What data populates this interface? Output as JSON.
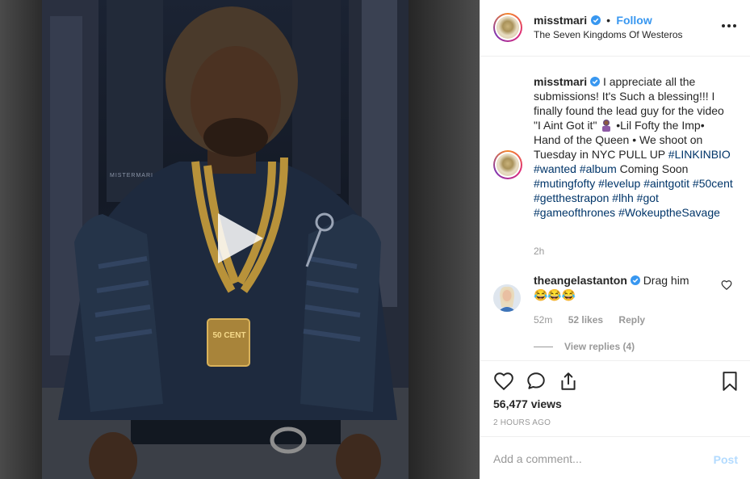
{
  "post": {
    "username": "misstmari",
    "follow_label": "Follow",
    "separator": "•",
    "location": "The Seven Kingdoms Of Westeros",
    "caption": {
      "text_1": "I appreciate all the submissions! It's Such a blessing!!! I finally found the lead guy for the video \"I Aint Got it\"",
      "text_2": "•Lil Fofty the Imp• Hand of the Queen • We shoot on Tuesday in NYC PULL UP",
      "hashtags_1": [
        "#LINKINBIO",
        "#wanted",
        "#album"
      ],
      "text_3": "Coming Soon",
      "hashtags_2": [
        "#mutingfofty",
        "#levelup",
        "#aintgotit",
        "#50cent",
        "#getthestrapon",
        "#lhh",
        "#got",
        "#gameofthrones",
        "#WokeuptheSavage"
      ],
      "time": "2h"
    },
    "comment": {
      "username": "theangelastanton",
      "text": "Drag him",
      "emoji": "😂😂😂",
      "time": "52m",
      "likes": "52 likes",
      "reply_label": "Reply"
    },
    "view_replies": "View replies (4)",
    "views": "56,477 views",
    "posted_ago": "2 HOURS AGO",
    "add_comment_placeholder": "Add a comment...",
    "post_label": "Post",
    "accent_color": "#3897f0",
    "media": {
      "overlay_text": "50 CENT",
      "watermark": "MISTERMARI"
    }
  }
}
